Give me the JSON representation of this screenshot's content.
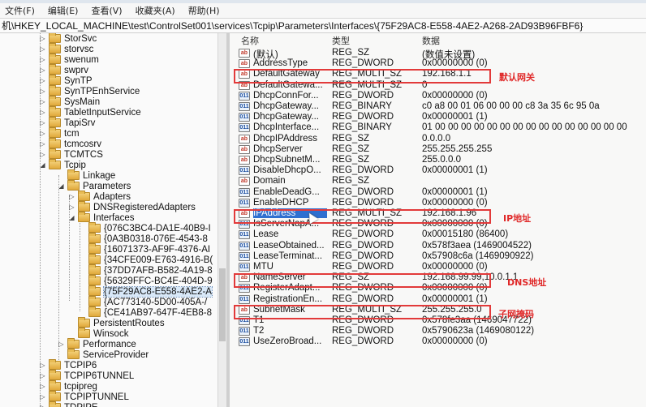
{
  "menu": {
    "items": [
      "文件(F)",
      "编辑(E)",
      "查看(V)",
      "收藏夹(A)",
      "帮助(H)"
    ]
  },
  "address": "机\\HKEY_LOCAL_MACHINE\\test\\ControlSet001\\services\\Tcpip\\Parameters\\Interfaces\\{75F29AC8-E558-4AE2-A268-2AD93B96FBF6}",
  "tree": {
    "items": [
      {
        "label": "StorSvc",
        "depth": 0,
        "expander": "▷"
      },
      {
        "label": "storvsc",
        "depth": 0,
        "expander": "▷"
      },
      {
        "label": "swenum",
        "depth": 0,
        "expander": "▷"
      },
      {
        "label": "swprv",
        "depth": 0,
        "expander": "▷"
      },
      {
        "label": "SynTP",
        "depth": 0,
        "expander": "▷"
      },
      {
        "label": "SynTPEnhService",
        "depth": 0,
        "expander": "▷"
      },
      {
        "label": "SysMain",
        "depth": 0,
        "expander": "▷"
      },
      {
        "label": "TabletInputService",
        "depth": 0,
        "expander": "▷"
      },
      {
        "label": "TapiSrv",
        "depth": 0,
        "expander": "▷"
      },
      {
        "label": "tcm",
        "depth": 0,
        "expander": "▷"
      },
      {
        "label": "tcmcosrv",
        "depth": 0,
        "expander": "▷"
      },
      {
        "label": "TCMTCS",
        "depth": 0,
        "expander": "▷"
      },
      {
        "label": "Tcpip",
        "depth": 0,
        "expander": "◢"
      },
      {
        "label": "Linkage",
        "depth": 1,
        "expander": ""
      },
      {
        "label": "Parameters",
        "depth": 1,
        "expander": "◢"
      },
      {
        "label": "Adapters",
        "depth": 2,
        "expander": "▷"
      },
      {
        "label": "DNSRegisteredAdapters",
        "depth": 2,
        "expander": "▷"
      },
      {
        "label": "Interfaces",
        "depth": 2,
        "expander": "◢"
      },
      {
        "label": "{076C3BC4-DA1E-40B9-I",
        "depth": 3,
        "expander": ""
      },
      {
        "label": "{0A3B0318-076E-4543-8",
        "depth": 3,
        "expander": ""
      },
      {
        "label": "{16071373-AF9F-4376-AI",
        "depth": 3,
        "expander": ""
      },
      {
        "label": "{34CFE009-E763-4916-B(",
        "depth": 3,
        "expander": ""
      },
      {
        "label": "{37DD7AFB-B582-4A19-8",
        "depth": 3,
        "expander": ""
      },
      {
        "label": "{56329FFC-BC4E-404D-9",
        "depth": 3,
        "expander": ""
      },
      {
        "label": "{75F29AC8-E558-4AE2-A",
        "depth": 3,
        "expander": "",
        "selected": true
      },
      {
        "label": "{AC773140-5D00-405A-/",
        "depth": 3,
        "expander": ""
      },
      {
        "label": "{CE41AB97-647F-4EB8-8",
        "depth": 3,
        "expander": ""
      },
      {
        "label": "PersistentRoutes",
        "depth": 2,
        "expander": ""
      },
      {
        "label": "Winsock",
        "depth": 2,
        "expander": ""
      },
      {
        "label": "Performance",
        "depth": 1,
        "expander": "▷"
      },
      {
        "label": "ServiceProvider",
        "depth": 1,
        "expander": ""
      },
      {
        "label": "TCPIP6",
        "depth": 0,
        "expander": "▷"
      },
      {
        "label": "TCPIP6TUNNEL",
        "depth": 0,
        "expander": "▷"
      },
      {
        "label": "tcpipreg",
        "depth": 0,
        "expander": "▷"
      },
      {
        "label": "TCPIPTUNNEL",
        "depth": 0,
        "expander": "▷"
      },
      {
        "label": "TDPIPE",
        "depth": 0,
        "expander": "▷"
      }
    ]
  },
  "values": {
    "headers": {
      "name": "名称",
      "type": "类型",
      "data": "数据"
    },
    "rows": [
      {
        "icon": "ab",
        "kind": "sz",
        "name": "(默认)",
        "type": "REG_SZ",
        "data": "(数值未设置)"
      },
      {
        "icon": "ab",
        "kind": "sz",
        "name": "AddressType",
        "type": "REG_DWORD",
        "data": "0x00000000 (0)"
      },
      {
        "icon": "ab",
        "kind": "sz",
        "name": "DefaultGateway",
        "type": "REG_MULTI_SZ",
        "data": "192.168.1.1"
      },
      {
        "icon": "ab",
        "kind": "sz",
        "name": "DefaultGatewa...",
        "type": "REG_MULTI_SZ",
        "data": "0"
      },
      {
        "icon": "011",
        "kind": "dw",
        "name": "DhcpConnFor...",
        "type": "REG_DWORD",
        "data": "0x00000000 (0)"
      },
      {
        "icon": "011",
        "kind": "dw",
        "name": "DhcpGateway...",
        "type": "REG_BINARY",
        "data": "c0 a8 00 01 06 00 00 00 c8 3a 35 6c 95 0a"
      },
      {
        "icon": "011",
        "kind": "dw",
        "name": "DhcpGateway...",
        "type": "REG_DWORD",
        "data": "0x00000001 (1)"
      },
      {
        "icon": "011",
        "kind": "dw",
        "name": "DhcpInterface...",
        "type": "REG_BINARY",
        "data": "01 00 00 00 00 00 00 00 00 00 00 00 00 00 00 00"
      },
      {
        "icon": "ab",
        "kind": "sz",
        "name": "DhcpIPAddress",
        "type": "REG_SZ",
        "data": "0.0.0.0"
      },
      {
        "icon": "ab",
        "kind": "sz",
        "name": "DhcpServer",
        "type": "REG_SZ",
        "data": "255.255.255.255"
      },
      {
        "icon": "ab",
        "kind": "sz",
        "name": "DhcpSubnetM...",
        "type": "REG_SZ",
        "data": "255.0.0.0"
      },
      {
        "icon": "011",
        "kind": "dw",
        "name": "DisableDhcpO...",
        "type": "REG_DWORD",
        "data": "0x00000001 (1)"
      },
      {
        "icon": "ab",
        "kind": "sz",
        "name": "Domain",
        "type": "REG_SZ",
        "data": ""
      },
      {
        "icon": "011",
        "kind": "dw",
        "name": "EnableDeadG...",
        "type": "REG_DWORD",
        "data": "0x00000001 (1)"
      },
      {
        "icon": "011",
        "kind": "dw",
        "name": "EnableDHCP",
        "type": "REG_DWORD",
        "data": "0x00000000 (0)"
      },
      {
        "icon": "ab",
        "kind": "sz",
        "name": "IPAddress",
        "type": "REG_MULTI_SZ",
        "data": "192.168.1.96",
        "selected": true
      },
      {
        "icon": "011",
        "kind": "dw",
        "name": "IsServerNapA...",
        "type": "REG_DWORD",
        "data": "0x00000000 (0)"
      },
      {
        "icon": "011",
        "kind": "dw",
        "name": "Lease",
        "type": "REG_DWORD",
        "data": "0x00015180 (86400)"
      },
      {
        "icon": "011",
        "kind": "dw",
        "name": "LeaseObtained...",
        "type": "REG_DWORD",
        "data": "0x578f3aea (1469004522)"
      },
      {
        "icon": "011",
        "kind": "dw",
        "name": "LeaseTerminat...",
        "type": "REG_DWORD",
        "data": "0x57908c6a (1469090922)"
      },
      {
        "icon": "011",
        "kind": "dw",
        "name": "MTU",
        "type": "REG_DWORD",
        "data": "0x00000000 (0)"
      },
      {
        "icon": "ab",
        "kind": "sz",
        "name": "NameServer",
        "type": "REG_SZ",
        "data": "192.168.99.99,10.0.1.1"
      },
      {
        "icon": "011",
        "kind": "dw",
        "name": "RegisterAdapt...",
        "type": "REG_DWORD",
        "data": "0x00000000 (0)"
      },
      {
        "icon": "011",
        "kind": "dw",
        "name": "RegistrationEn...",
        "type": "REG_DWORD",
        "data": "0x00000001 (1)"
      },
      {
        "icon": "ab",
        "kind": "sz",
        "name": "SubnetMask",
        "type": "REG_MULTI_SZ",
        "data": "255.255.255.0"
      },
      {
        "icon": "011",
        "kind": "dw",
        "name": "T1",
        "type": "REG_DWORD",
        "data": "0x578fe3aa (1469047722)"
      },
      {
        "icon": "011",
        "kind": "dw",
        "name": "T2",
        "type": "REG_DWORD",
        "data": "0x5790623a (1469080122)"
      },
      {
        "icon": "011",
        "kind": "dw",
        "name": "UseZeroBroad...",
        "type": "REG_DWORD",
        "data": "0x00000000 (0)"
      }
    ]
  },
  "annotations": {
    "gateway": "默认网关",
    "ip": "IP地址",
    "dns": "DNS地址",
    "mask": "子网掩码"
  },
  "colors": {
    "highlight_box": "#e23a3a",
    "annotation_text": "#e02828",
    "selected_row": "#2f6fd0"
  }
}
